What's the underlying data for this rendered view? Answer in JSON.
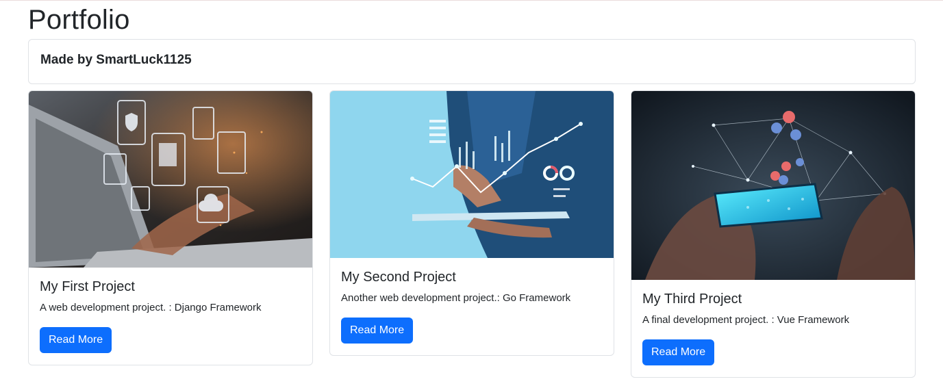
{
  "page": {
    "title": "Portfolio",
    "subtitle": "Made by SmartLuck1125"
  },
  "projects": [
    {
      "title": "My First Project",
      "description": "A web development project. : Django Framework",
      "button_label": "Read More",
      "image_icon": "laptop-cloud-security-icon"
    },
    {
      "title": "My Second Project",
      "description": "Another web development project.: Go Framework",
      "button_label": "Read More",
      "image_icon": "tablet-growth-chart-icon"
    },
    {
      "title": "My Third Project",
      "description": "A final development project. : Vue Framework",
      "button_label": "Read More",
      "image_icon": "phone-social-network-icon"
    }
  ],
  "colors": {
    "primary_button": "#0d6efd",
    "card_border": "#dfe2e6",
    "text": "#212529"
  }
}
